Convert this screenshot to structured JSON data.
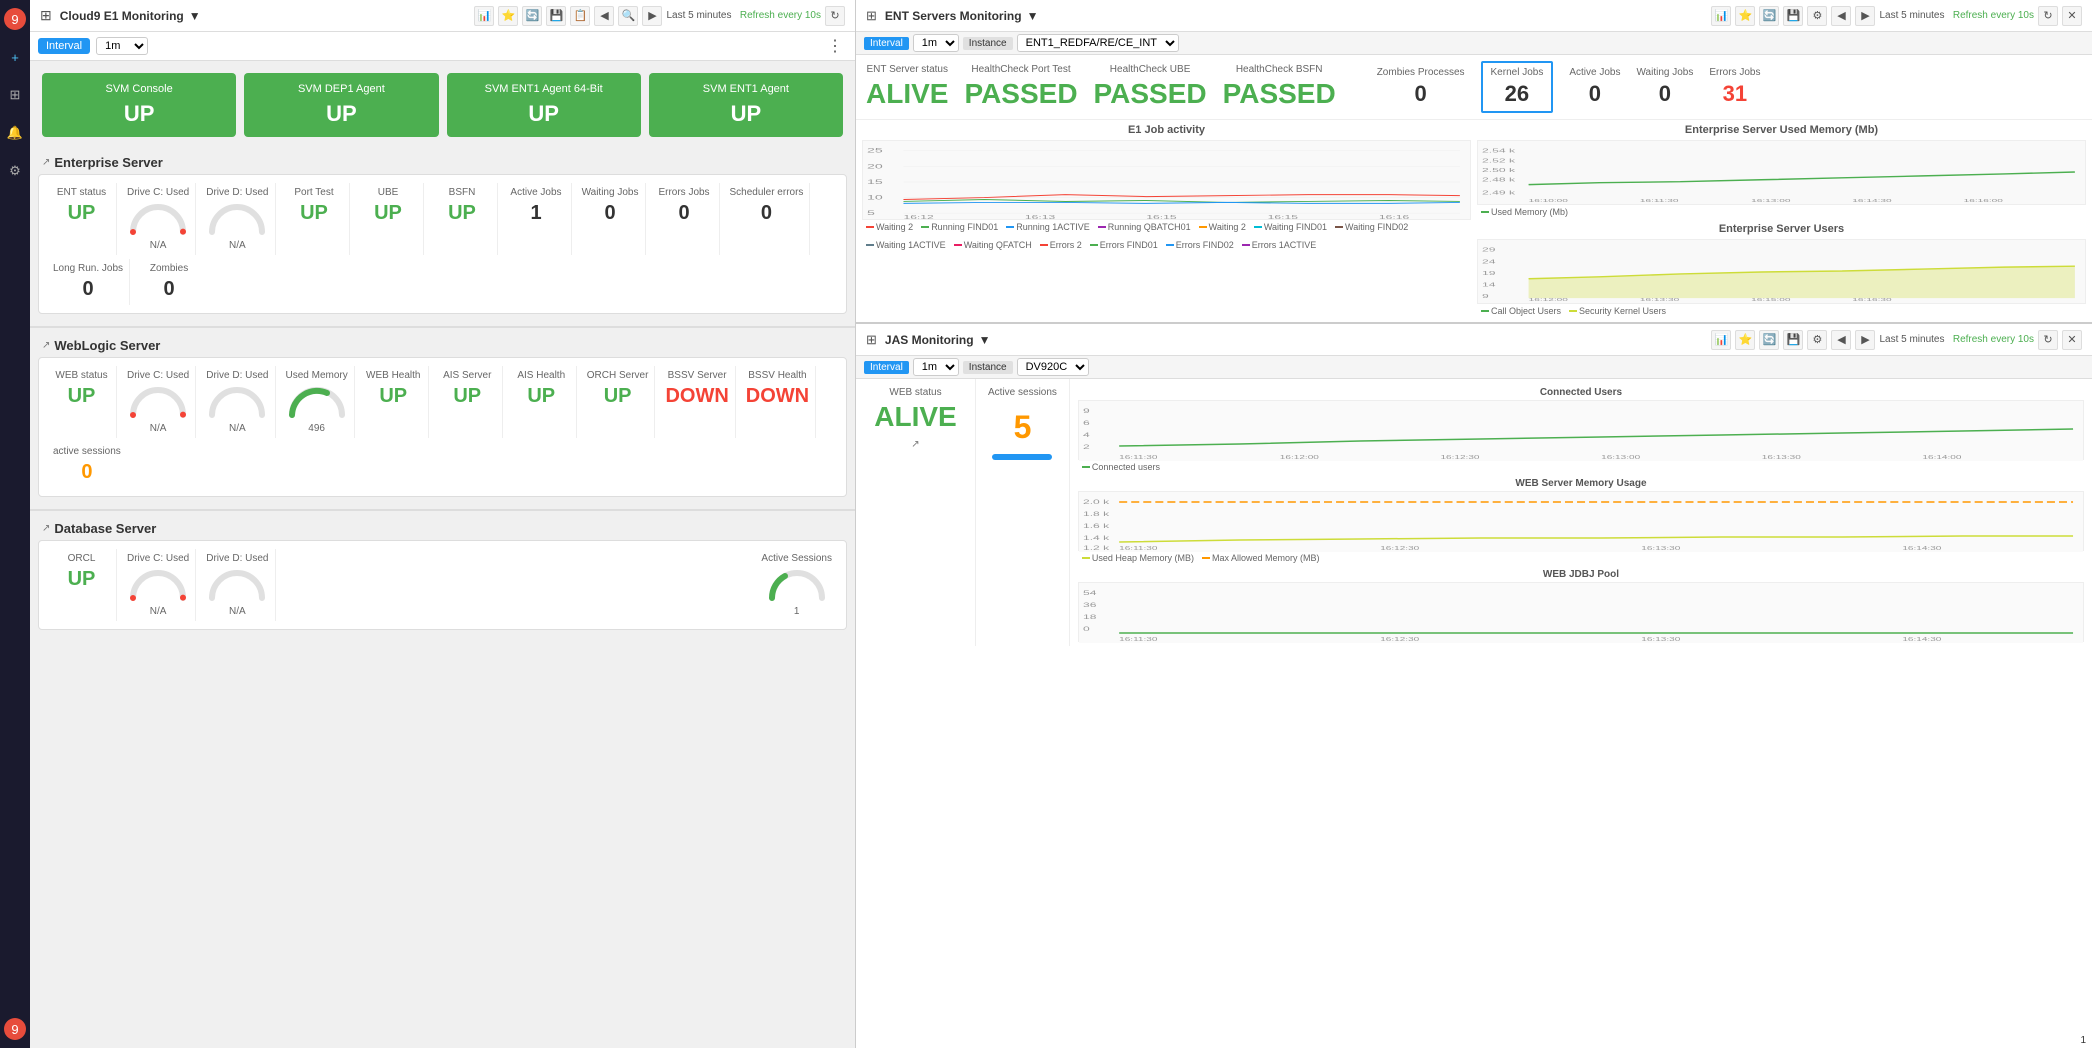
{
  "sidebar": {
    "logo": "9",
    "icons": [
      "+",
      "⊞",
      "🔔",
      "⚙",
      "👤"
    ]
  },
  "left_panel": {
    "header": {
      "title": "Cloud9 E1 Monitoring",
      "dropdown_arrow": "▼",
      "icons": [
        "📊",
        "⭐",
        "🔄",
        "💾",
        "📋",
        "◀",
        "🔍",
        "▶"
      ],
      "refresh_text": "Last 5 minutes",
      "refresh_link": "Refresh every 10s",
      "refresh_icon": "↻"
    },
    "interval": {
      "tab_interval": "Interval",
      "tab_1m": "1m ▼",
      "kebab": "⋮"
    },
    "svm_cards": [
      {
        "label": "SVM Console",
        "value": "UP"
      },
      {
        "label": "SVM DEP1 Agent",
        "value": "UP"
      },
      {
        "label": "SVM ENT1 Agent 64-Bit",
        "value": "UP"
      },
      {
        "label": "SVM ENT1 Agent",
        "value": "UP"
      }
    ],
    "enterprise_server": {
      "title": "Enterprise Server",
      "expand_icon": "↗",
      "metrics": [
        {
          "label": "ENT status",
          "value": "UP",
          "type": "text",
          "color": "green"
        },
        {
          "label": "Drive C: Used",
          "value": "N/A",
          "type": "gauge"
        },
        {
          "label": "Drive D: Used",
          "value": "N/A",
          "type": "gauge"
        },
        {
          "label": "Port Test",
          "value": "UP",
          "type": "text",
          "color": "green"
        },
        {
          "label": "UBE",
          "value": "UP",
          "type": "text",
          "color": "green"
        },
        {
          "label": "BSFN",
          "value": "UP",
          "type": "text",
          "color": "green"
        },
        {
          "label": "Active Jobs",
          "value": "1",
          "type": "text",
          "color": "black"
        },
        {
          "label": "Waiting Jobs",
          "value": "0",
          "type": "text",
          "color": "black"
        },
        {
          "label": "Errors Jobs",
          "value": "0",
          "type": "text",
          "color": "black"
        },
        {
          "label": "Scheduler errors",
          "value": "0",
          "type": "text",
          "color": "black"
        },
        {
          "label": "Long Run. Jobs",
          "value": "0",
          "type": "text",
          "color": "black"
        },
        {
          "label": "Zombies",
          "value": "0",
          "type": "text",
          "color": "black"
        }
      ]
    },
    "weblogic_server": {
      "title": "WebLogic Server",
      "expand_icon": "↗",
      "metrics": [
        {
          "label": "WEB status",
          "value": "UP",
          "type": "text",
          "color": "green"
        },
        {
          "label": "Drive C: Used",
          "value": "N/A",
          "type": "gauge"
        },
        {
          "label": "Drive D: Used",
          "value": "N/A",
          "type": "gauge"
        },
        {
          "label": "Used Memory",
          "value": "496",
          "type": "gauge_num"
        },
        {
          "label": "WEB Health",
          "value": "UP",
          "type": "text",
          "color": "green"
        },
        {
          "label": "AIS Server",
          "value": "UP",
          "type": "text",
          "color": "green"
        },
        {
          "label": "AIS Health",
          "value": "UP",
          "type": "text",
          "color": "green"
        },
        {
          "label": "ORCH Server",
          "value": "UP",
          "type": "text",
          "color": "green"
        },
        {
          "label": "BSSV Server",
          "value": "DOWN",
          "type": "text",
          "color": "red"
        },
        {
          "label": "BSSV Health",
          "value": "DOWN",
          "type": "text",
          "color": "red"
        },
        {
          "label": "active sessions",
          "value": "0",
          "type": "text",
          "color": "orange"
        }
      ]
    },
    "database_server": {
      "title": "Database Server",
      "expand_icon": "↗",
      "metrics": [
        {
          "label": "ORCL",
          "value": "UP",
          "type": "text",
          "color": "green"
        },
        {
          "label": "Drive C: Used",
          "value": "N/A",
          "type": "gauge"
        },
        {
          "label": "Drive D: Used",
          "value": "N/A",
          "type": "gauge"
        },
        {
          "label": "Active Sessions",
          "value": "1",
          "type": "gauge_num"
        }
      ]
    }
  },
  "right_panel": {
    "ent_monitoring": {
      "header_title": "ENT Servers Monitoring",
      "dropdown_arrow": "▼",
      "tabs": [
        "Interval",
        "1m ▼",
        "Instance",
        "ENT1_REDFA/RE/CE_INT ▼"
      ],
      "status_items": [
        {
          "label": "ENT Server status",
          "value": "ALIVE",
          "color": "green",
          "size": "big"
        },
        {
          "label": "HealthCheck Port Test",
          "value": "PASSED",
          "color": "green",
          "size": "big"
        },
        {
          "label": "HealthCheck UBE",
          "value": "PASSED",
          "color": "green",
          "size": "big"
        },
        {
          "label": "HealthCheck BSFN",
          "value": "PASSED",
          "color": "green",
          "size": "big"
        },
        {
          "label": "Zombies Processes",
          "value": "0",
          "color": "black",
          "size": "medium"
        },
        {
          "label": "Kernel Jobs",
          "value": "26",
          "color": "black",
          "size": "medium"
        },
        {
          "label": "Active Jobs",
          "value": "0",
          "color": "black",
          "size": "medium"
        },
        {
          "label": "Waiting Jobs",
          "value": "0",
          "color": "black",
          "size": "medium"
        },
        {
          "label": "Errors Jobs",
          "value": "31",
          "color": "red",
          "size": "medium"
        }
      ],
      "charts": [
        {
          "title": "E1 Job activity",
          "side": "left"
        },
        {
          "title": "Enterprise Server Used Memory (Mb)",
          "side": "right"
        },
        {
          "title": "Enterprise Server Users",
          "side": "right2"
        }
      ],
      "legend_items": [
        {
          "label": "Waiting 2",
          "color": "#f44336"
        },
        {
          "label": "Running FIND01",
          "color": "#4caf50"
        },
        {
          "label": "Running 1ACTIVE",
          "color": "#2196f3"
        },
        {
          "label": "Running QBATCH01",
          "color": "#9c27b0"
        },
        {
          "label": "Waiting 2",
          "color": "#ff9800"
        },
        {
          "label": "Waiting FIND01",
          "color": "#00bcd4"
        },
        {
          "label": "Waiting FIND02",
          "color": "#795548"
        },
        {
          "label": "Waiting 1ACTIVE",
          "color": "#607d8b"
        },
        {
          "label": "Waiting QFATCH",
          "color": "#e91e63"
        },
        {
          "label": "Errors 2",
          "color": "#f44336"
        },
        {
          "label": "Errors FIND01",
          "color": "#4caf50"
        },
        {
          "label": "Errors FIND02",
          "color": "#2196f3"
        },
        {
          "label": "Errors 1ACTIVE",
          "color": "#9c27b0"
        }
      ],
      "mem_legend": [
        {
          "label": "Used Memory (Mb)",
          "color": "#4caf50"
        }
      ],
      "users_legend": [
        {
          "label": "Call Object Users",
          "color": "#4caf50"
        },
        {
          "label": "Security Kernel Users",
          "color": "#cddc39"
        }
      ]
    },
    "jas_monitoring": {
      "header_title": "JAS Monitoring",
      "dropdown_arrow": "▼",
      "tabs": [
        "Interval",
        "1m ▼",
        "Instance",
        "DV920C ▼"
      ],
      "status_items": [
        {
          "label": "WEB status",
          "value": "ALIVE",
          "color": "green",
          "size": "big"
        },
        {
          "label": "Active sessions",
          "value": "5",
          "color": "orange",
          "size": "big"
        }
      ],
      "charts": [
        {
          "title": "Connected Users"
        },
        {
          "title": "WEB Server Memory Usage"
        },
        {
          "title": "WEB JDBJ Pool"
        }
      ],
      "mem_legend": [
        {
          "label": "Used Heap Memory (MB)",
          "color": "#cddc39"
        },
        {
          "label": "Max Allowed Memory (MB)",
          "color": "#ff9800"
        }
      ]
    },
    "refresh_text": "Last 5 minutes",
    "refresh_link": "Refresh every 10s"
  }
}
